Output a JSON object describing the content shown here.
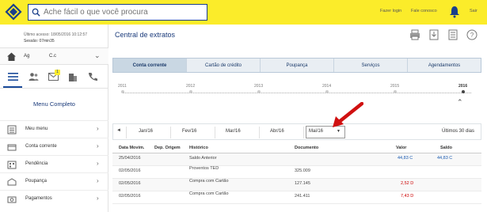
{
  "header": {
    "search_placeholder": "Ache fácil o que você procura",
    "links": [
      "Fazer login",
      "Fale conosco",
      "Sair"
    ]
  },
  "sidebar": {
    "last_access": "Último acesso: 18/05/2016 10:12:57",
    "session": "Sessão: 07min35",
    "agency_label": "Ag",
    "account_label": "C.c",
    "menu_title": "Menu Completo",
    "items": [
      {
        "label": "Meu menu",
        "icon": "my-menu-icon"
      },
      {
        "label": "Conta corrente",
        "icon": "checking-account-icon"
      },
      {
        "label": "Pendência",
        "icon": "pending-icon"
      },
      {
        "label": "Poupança",
        "icon": "savings-icon"
      },
      {
        "label": "Pagamentos",
        "icon": "payments-icon"
      }
    ],
    "notification_badge": "1"
  },
  "main": {
    "title": "Central de extratos",
    "tabs": [
      "Conta corrente",
      "Cartão de crédito",
      "Poupança",
      "Serviços",
      "Agendamentos"
    ],
    "active_tab": "Conta corrente",
    "years": [
      "2011",
      "2012",
      "2013",
      "2014",
      "2015",
      "2016"
    ],
    "current_year": "2016",
    "months": [
      "Jan/16",
      "Fev/16",
      "Mar/16",
      "Abr/16"
    ],
    "selected_month": "Mai/16",
    "last_days": "Últimos 30 dias",
    "prev_arrow": "◄"
  },
  "table": {
    "headers": [
      "Data Movim.",
      "Dep. Origem",
      "Histórico",
      "Documento",
      "Valor",
      "Saldo"
    ],
    "rows": [
      {
        "date": "25/04/2016",
        "origin": "",
        "history": "Saldo Anterior",
        "doc": "",
        "value": "44,83 C",
        "balance": "44,83 C",
        "value_color": "blue"
      },
      {
        "date": "02/05/2016",
        "origin": "",
        "history": "Proventos TED",
        "doc": "325.009",
        "value": "",
        "balance": "",
        "value_color": ""
      },
      {
        "date": "02/05/2016",
        "origin": "",
        "history": "Compra com Cartão",
        "doc": "127.145",
        "value": "2,52 D",
        "balance": "",
        "value_color": "red"
      },
      {
        "date": "02/05/2016",
        "origin": "",
        "history": "Compra com Cartão",
        "doc": "241.411",
        "value": "7,43 D",
        "balance": "",
        "value_color": "red"
      }
    ]
  },
  "colors": {
    "brand_yellow": "#fbec2a",
    "brand_blue": "#1a3f8a",
    "debit_red": "#cc0000",
    "credit_blue": "#1a5ab0"
  }
}
